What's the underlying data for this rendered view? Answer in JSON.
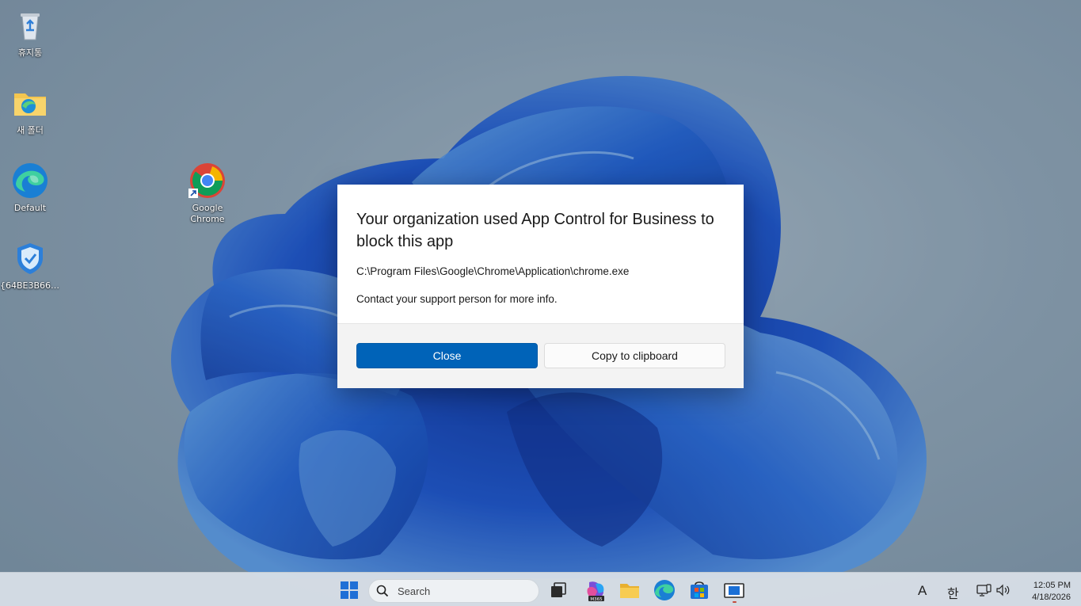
{
  "desktop": {
    "icons": [
      {
        "label": "휴지통",
        "icon": "recycle-bin-icon"
      },
      {
        "label": "새 폴더",
        "icon": "folder-icon"
      },
      {
        "label": "Default",
        "icon": "edge-icon"
      },
      {
        "label": "{64BE3B66-...",
        "icon": "shield-icon"
      },
      {
        "label": "Google Chrome",
        "icon": "chrome-icon"
      }
    ]
  },
  "dialog": {
    "title": "Your organization used App Control for Business to block this app",
    "path": "C:\\Program Files\\Google\\Chrome\\Application\\chrome.exe",
    "info": "Contact your support person for more info.",
    "close_label": "Close",
    "copy_label": "Copy to clipboard"
  },
  "taskbar": {
    "search_placeholder": "Search",
    "apps": [
      "start-icon",
      "task-view-icon",
      "m365-copilot-icon",
      "file-explorer-icon",
      "edge-icon",
      "store-icon",
      "app-icon"
    ],
    "m365_badge": "M365",
    "ime_mode": "A",
    "ime_lang": "한",
    "time": "12:05 PM",
    "date": "4/18/2026"
  },
  "colors": {
    "accent": "#0063b8",
    "wallpaper_blue": "#1a56c8"
  }
}
